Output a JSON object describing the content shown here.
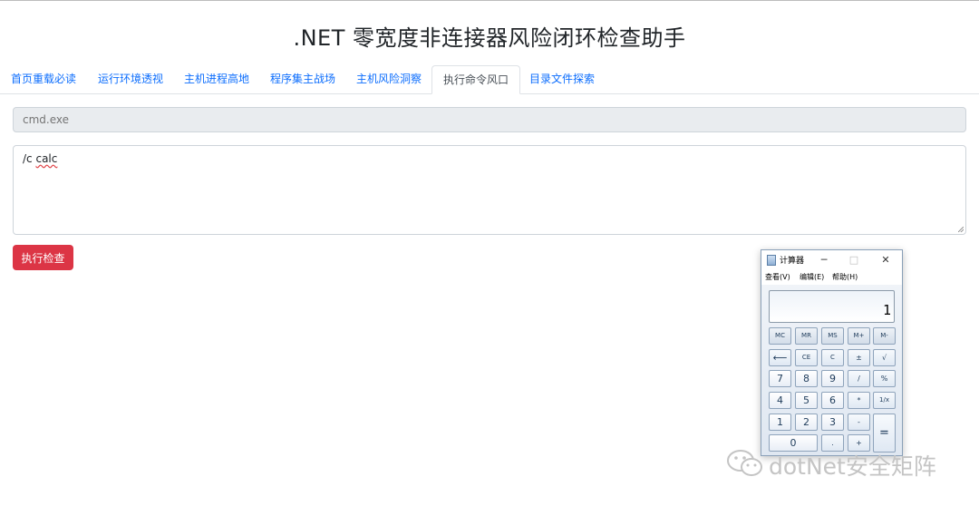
{
  "page": {
    "title": ".NET 零宽度非连接器风险闭环检查助手"
  },
  "tabs": [
    {
      "label": "首页重载必读",
      "active": false
    },
    {
      "label": "运行环境透视",
      "active": false
    },
    {
      "label": "主机进程高地",
      "active": false
    },
    {
      "label": "程序集主战场",
      "active": false
    },
    {
      "label": "主机风险洞察",
      "active": false
    },
    {
      "label": "执行命令风口",
      "active": true
    },
    {
      "label": "目录文件探索",
      "active": false
    }
  ],
  "form": {
    "command_placeholder": "cmd.exe",
    "args_prefix": "/c ",
    "args_word": "calc",
    "execute_label": "执行检查",
    "execute_color": "#dc3545"
  },
  "calculator": {
    "title": "计算器",
    "minimize": "─",
    "maximize": "□",
    "close": "✕",
    "menu": [
      "查看(V)",
      "编辑(E)",
      "帮助(H)"
    ],
    "display": "1",
    "keys": {
      "mc": "MC",
      "mr": "MR",
      "ms": "MS",
      "mplus": "M+",
      "mminus": "M-",
      "back": "⟵",
      "ce": "CE",
      "c": "C",
      "plusminus": "±",
      "sqrt": "√",
      "n7": "7",
      "n8": "8",
      "n9": "9",
      "div": "/",
      "pct": "%",
      "n4": "4",
      "n5": "5",
      "n6": "6",
      "mul": "*",
      "recip": "1/x",
      "n1": "1",
      "n2": "2",
      "n3": "3",
      "sub": "-",
      "eq": "=",
      "n0": "0",
      "dot": ".",
      "add": "+"
    }
  },
  "watermark": {
    "text": "dotNet安全矩阵",
    "icon": "wechat-icon"
  }
}
